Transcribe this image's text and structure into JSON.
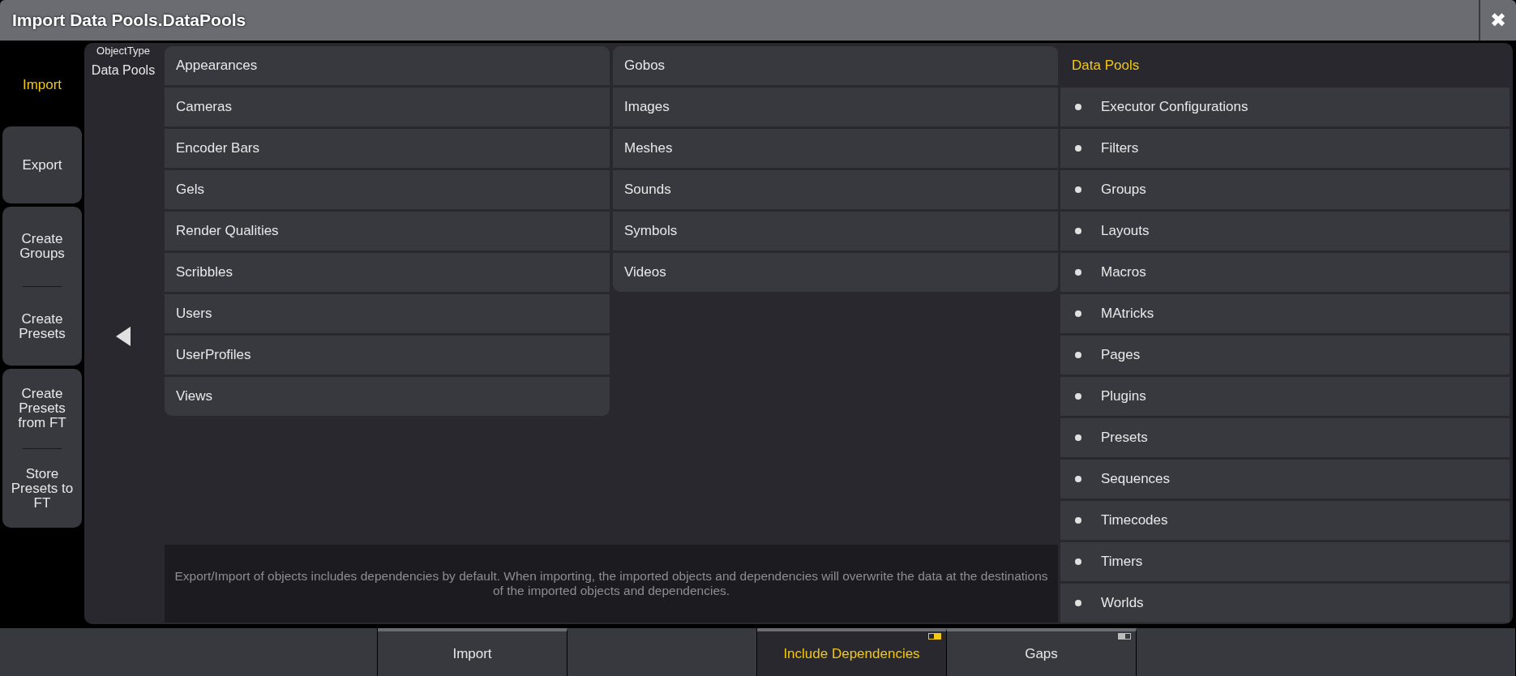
{
  "window": {
    "title": "Import Data Pools.DataPools",
    "close": "✖"
  },
  "sidebar": {
    "tabs": [
      {
        "label": "Import",
        "selected": true
      },
      {
        "label": "Export",
        "selected": false
      }
    ],
    "groups": [
      [
        "Create Groups",
        "Create Presets"
      ],
      [
        "Create Presets from FT",
        "Store Presets to FT"
      ]
    ]
  },
  "object_type": {
    "caption": "ObjectType",
    "value": "Data Pools"
  },
  "column_1": [
    "Appearances",
    "Cameras",
    "Encoder Bars",
    "Gels",
    "Render Qualities",
    "Scribbles",
    "Users",
    "UserProfiles",
    "Views"
  ],
  "column_2": [
    "Gobos",
    "Images",
    "Meshes",
    "Sounds",
    "Symbols",
    "Videos"
  ],
  "info": "Export/Import of objects includes dependencies by default. When importing, the imported objects and dependencies will overwrite the data at the destinations of the imported objects and dependencies.",
  "selection": {
    "title": "Data Pools",
    "items": [
      "Executor Configurations",
      "Filters",
      "Groups",
      "Layouts",
      "Macros",
      "MAtricks",
      "Pages",
      "Plugins",
      "Presets",
      "Sequences",
      "Timecodes",
      "Timers",
      "Worlds"
    ]
  },
  "bottom_bar": [
    {
      "kind": "empty"
    },
    {
      "kind": "button",
      "label": "Import"
    },
    {
      "kind": "empty"
    },
    {
      "kind": "toggle",
      "label": "Include Dependencies",
      "on": true
    },
    {
      "kind": "toggle",
      "label": "Gaps",
      "on": false
    },
    {
      "kind": "empty"
    }
  ]
}
